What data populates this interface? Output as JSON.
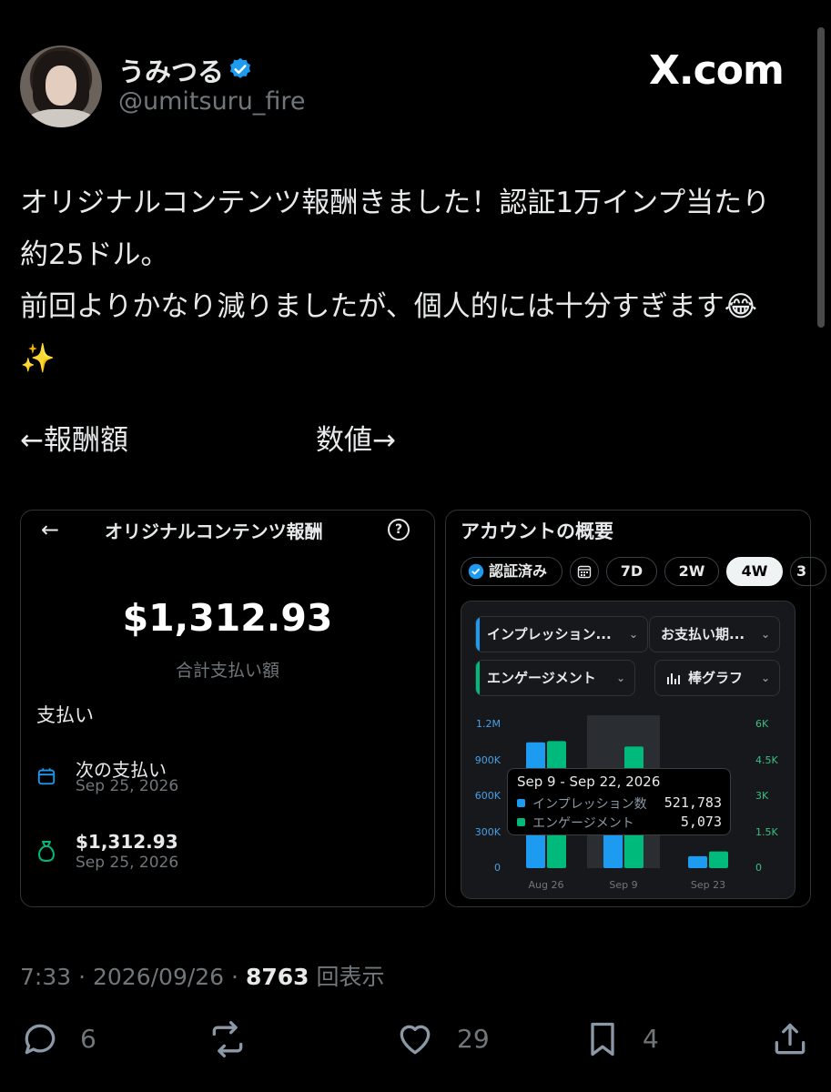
{
  "header": {
    "display_name": "うみつる",
    "handle": "@umitsuru_fire",
    "watermark": "X.com"
  },
  "tweet": {
    "text": "オリジナルコンテンツ報酬きました！認証1万インプ当たり\n約25ドル。\n前回よりかなり減りましたが、個人的には十分すぎます😂\n✨",
    "left_caption": "←報酬額",
    "right_caption": "数値→"
  },
  "payout_card": {
    "title": "オリジナルコンテンツ報酬",
    "total_amount": "$1,312.93",
    "total_label": "合計支払い額",
    "section_heading": "支払い",
    "next_payment_label": "次の支払い",
    "next_payment_date": "Sep 25, 2026",
    "payment_amount": "$1,312.93",
    "payment_date": "Sep 25, 2026"
  },
  "analytics_card": {
    "title": "アカウントの概要",
    "filters": [
      "認証済み",
      "7D",
      "2W",
      "4W",
      "3"
    ],
    "active_filter": "4W",
    "selectors": {
      "metric1": "インプレッション...",
      "period": "お支払い期...",
      "metric2": "エンゲージメント",
      "chart_type": "棒グラフ"
    },
    "tooltip": {
      "range": "Sep 9 - Sep 22, 2026",
      "impressions_label": "インプレッション数",
      "impressions_value": "521,783",
      "engagement_label": "エンゲージメント",
      "engagement_value": "5,073"
    },
    "colors": {
      "impressions": "#1d9bf0",
      "engagement": "#00ba7c"
    }
  },
  "chart_data": {
    "type": "bar",
    "categories": [
      "Aug 26",
      "Sep 9",
      "Sep 23"
    ],
    "series": [
      {
        "name": "インプレッション数",
        "axis": "left",
        "values": [
          1050000,
          521783,
          100000
        ]
      },
      {
        "name": "エンゲージメント",
        "axis": "right",
        "values": [
          5300,
          5073,
          700
        ]
      }
    ],
    "left_axis": {
      "ticks": [
        "0",
        "300K",
        "600K",
        "900K",
        "1.2M"
      ],
      "ylim": [
        0,
        1200000
      ]
    },
    "right_axis": {
      "ticks": [
        "0",
        "1.5K",
        "3K",
        "4.5K",
        "6K"
      ],
      "ylim": [
        0,
        6000
      ]
    },
    "highlighted_category": "Sep 9"
  },
  "footer": {
    "time": "7:33",
    "date": "2026/09/26",
    "views": "8763",
    "views_label": "回表示",
    "replies": "6",
    "reposts": "",
    "likes": "29",
    "bookmarks": "4"
  }
}
